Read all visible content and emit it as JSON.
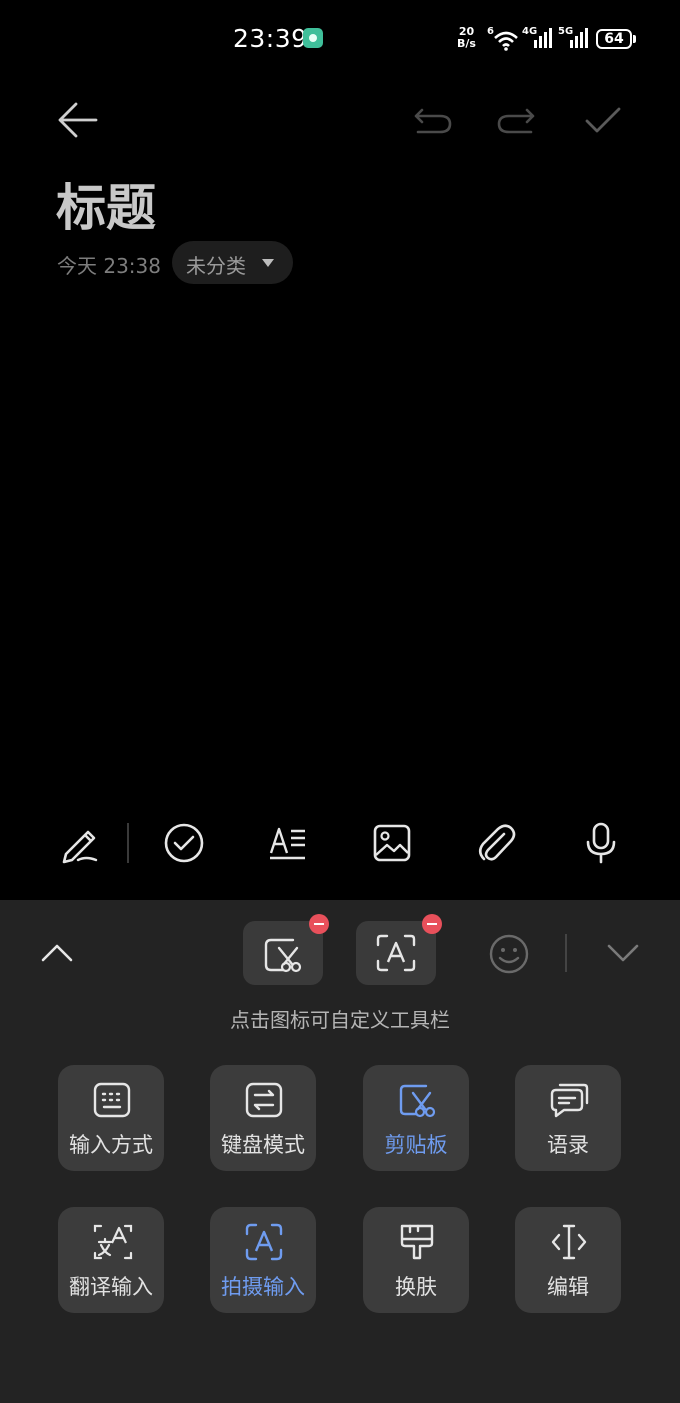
{
  "status_bar": {
    "time": "23:39",
    "net_speed_top": "20",
    "net_speed_bottom": "B/s",
    "wifi_label": "6",
    "sim1_label": "4G",
    "sim2_label": "5G",
    "battery": "64"
  },
  "note": {
    "title": "标题",
    "date": "今天 23:38",
    "category": "未分类"
  },
  "header_icons": [
    "back-arrow-icon",
    "undo-icon",
    "redo-icon",
    "check-icon"
  ],
  "bottom_toolbar": [
    "pen-icon",
    "checklist-icon",
    "text-format-icon",
    "image-icon",
    "attachment-icon",
    "microphone-icon"
  ],
  "keyboard": {
    "hint": "点击图标可自定义工具栏",
    "toolbar_items": [
      "clipboard-icon",
      "ocr-icon",
      "emoji-icon"
    ],
    "tiles": [
      {
        "label": "输入方式",
        "icon": "keyboard-icon",
        "active": false
      },
      {
        "label": "键盘模式",
        "icon": "swap-icon",
        "active": false
      },
      {
        "label": "剪贴板",
        "icon": "clipboard-icon",
        "active": true
      },
      {
        "label": "语录",
        "icon": "messages-icon",
        "active": false
      },
      {
        "label": "翻译输入",
        "icon": "translate-icon",
        "active": false
      },
      {
        "label": "拍摄输入",
        "icon": "camera-text-icon",
        "active": true
      },
      {
        "label": "换肤",
        "icon": "paint-brush-icon",
        "active": false
      },
      {
        "label": "编辑",
        "icon": "cursor-icon",
        "active": false
      }
    ]
  },
  "colors": {
    "accent": "#6f9cf0",
    "panel": "#232323",
    "tile": "#3c3c3c",
    "badge": "#e8505b"
  }
}
